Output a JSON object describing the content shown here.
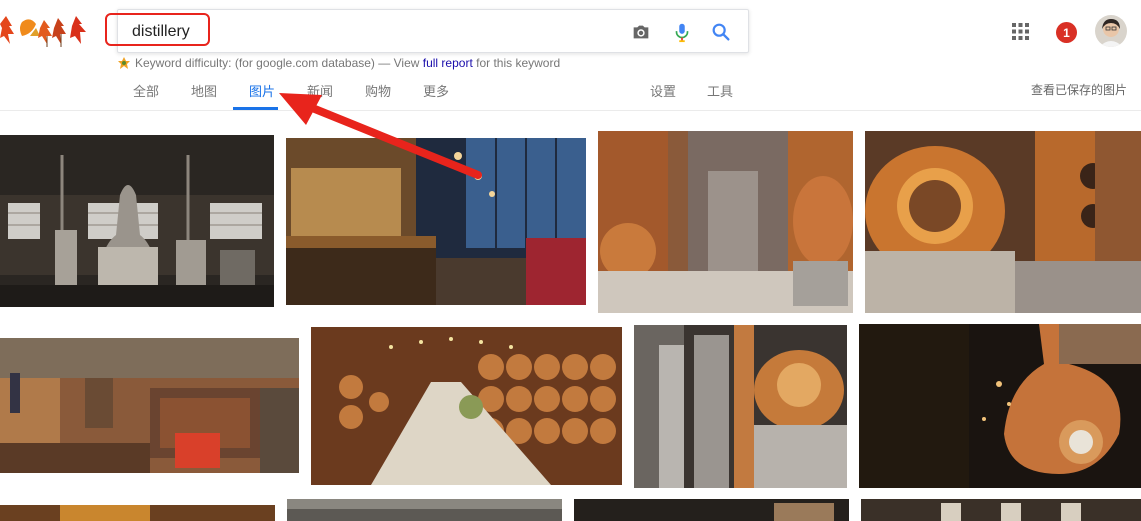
{
  "search": {
    "query": "distillery"
  },
  "keyword_difficulty": {
    "label": "Keyword difficulty:",
    "note": "(for google.com database) —",
    "view": "View",
    "link": "full report",
    "tail": "for this keyword"
  },
  "tabs": [
    {
      "label": "全部"
    },
    {
      "label": "地图"
    },
    {
      "label": "图片",
      "active": true
    },
    {
      "label": "新闻"
    },
    {
      "label": "购物"
    },
    {
      "label": "更多"
    },
    {
      "label": "设置"
    },
    {
      "label": "工具"
    }
  ],
  "saved_images_label": "查看已保存的图片",
  "notification_count": "1",
  "colors": {
    "accent": "#1a73e8",
    "annotation": "#e8241c",
    "link": "#1a0dab",
    "badge": "#d93025"
  },
  "icons": [
    "autumn-leaves-logo",
    "camera-icon",
    "mic-icon",
    "search-icon",
    "apps-grid-icon",
    "user-avatar",
    "leaf-icon"
  ]
}
